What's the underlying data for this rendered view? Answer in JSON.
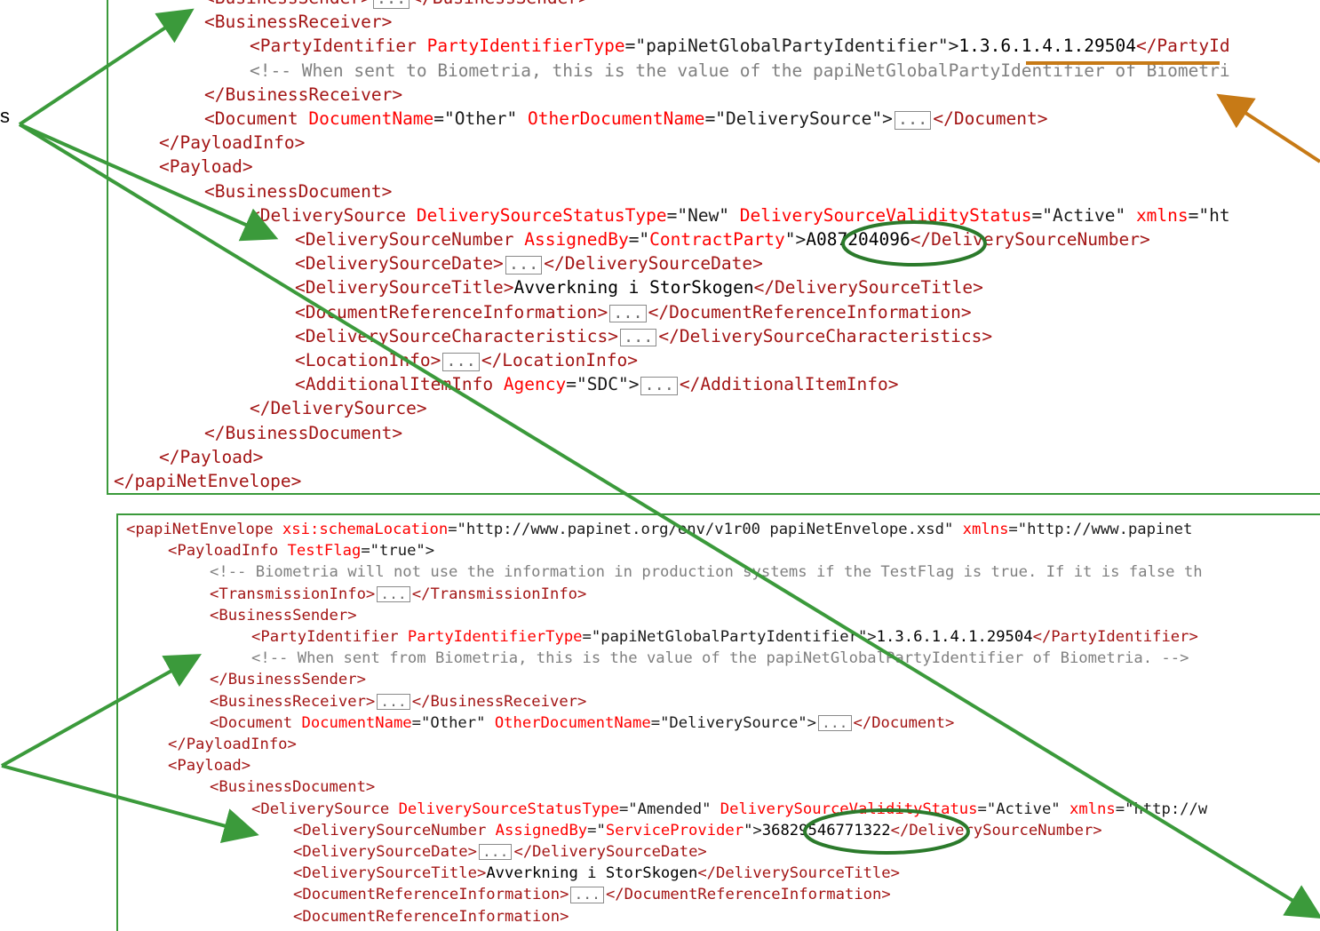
{
  "left_label": "s",
  "top_panel": {
    "lines": [
      {
        "indent": 0,
        "parts": [
          [
            "t",
            "<BusinessSender>"
          ],
          [
            "f",
            "..."
          ],
          [
            "t",
            "</BusinessSender>"
          ]
        ]
      },
      {
        "indent": 0,
        "parts": [
          [
            "t",
            "<BusinessReceiver>"
          ]
        ]
      },
      {
        "indent": 1,
        "parts": [
          [
            "t",
            "<PartyIdentifier "
          ],
          [
            "a",
            "PartyIdentifierType"
          ],
          [
            "v",
            "=\""
          ],
          [
            "v",
            "papiNetGlobalPartyIdentifier"
          ],
          [
            "v",
            "\">"
          ],
          [
            "tx",
            "1.3.6.1.4.1.29504"
          ],
          [
            "t",
            "</PartyId"
          ]
        ]
      },
      {
        "indent": 1,
        "parts": [
          [
            "c",
            "<!-- When sent to Biometria, this is the value of the papiNetGlobalPartyIdentifier of Biometri"
          ]
        ]
      },
      {
        "indent": 0,
        "parts": [
          [
            "t",
            "</BusinessReceiver>"
          ]
        ]
      },
      {
        "indent": 0,
        "parts": [
          [
            "t",
            "<Document "
          ],
          [
            "a",
            "DocumentName"
          ],
          [
            "v",
            "=\"Other\" "
          ],
          [
            "a",
            "OtherDocumentName"
          ],
          [
            "v",
            "=\"DeliverySource\">"
          ],
          [
            "f",
            "..."
          ],
          [
            "t",
            "</Document>"
          ]
        ]
      },
      {
        "indent": -1,
        "parts": [
          [
            "t",
            "</PayloadInfo>"
          ]
        ]
      },
      {
        "indent": -1,
        "parts": [
          [
            "t",
            "<Payload>"
          ]
        ]
      },
      {
        "indent": 0,
        "parts": [
          [
            "t",
            "<BusinessDocument>"
          ]
        ]
      },
      {
        "indent": 1,
        "parts": [
          [
            "t",
            "<DeliverySource "
          ],
          [
            "a",
            "DeliverySourceStatusType"
          ],
          [
            "v",
            "=\"New\" "
          ],
          [
            "a",
            "DeliverySourceValidityStatus"
          ],
          [
            "v",
            "=\"Active\" "
          ],
          [
            "a",
            "xmlns"
          ],
          [
            "v",
            "=\"ht"
          ]
        ]
      },
      {
        "indent": 2,
        "parts": [
          [
            "t",
            "<DeliverySourceNumber "
          ],
          [
            "a2",
            "AssignedBy"
          ],
          [
            "v",
            "=\""
          ],
          [
            "a",
            "ContractParty"
          ],
          [
            "v",
            "\">"
          ],
          [
            "tx",
            "A087204096"
          ],
          [
            "t",
            "</DeliverySourceNumber>"
          ]
        ]
      },
      {
        "indent": 2,
        "parts": [
          [
            "t",
            "<DeliverySourceDate>"
          ],
          [
            "f",
            "..."
          ],
          [
            "t",
            "</DeliverySourceDate>"
          ]
        ]
      },
      {
        "indent": 2,
        "parts": [
          [
            "t",
            "<DeliverySourceTitle>"
          ],
          [
            "tx",
            "Avverkning i StorSkogen"
          ],
          [
            "t",
            "</DeliverySourceTitle>"
          ]
        ]
      },
      {
        "indent": 2,
        "parts": [
          [
            "t",
            "<DocumentReferenceInformation>"
          ],
          [
            "f",
            "..."
          ],
          [
            "t",
            "</DocumentReferenceInformation>"
          ]
        ]
      },
      {
        "indent": 2,
        "parts": [
          [
            "t",
            "<DeliverySourceCharacteristics>"
          ],
          [
            "f",
            "..."
          ],
          [
            "t",
            "</DeliverySourceCharacteristics>"
          ]
        ]
      },
      {
        "indent": 2,
        "parts": [
          [
            "t",
            "<LocationInfo>"
          ],
          [
            "f",
            "..."
          ],
          [
            "t",
            "</LocationInfo>"
          ]
        ]
      },
      {
        "indent": 2,
        "parts": [
          [
            "t",
            "<AdditionalItemInfo "
          ],
          [
            "a",
            "Agency"
          ],
          [
            "v",
            "=\"SDC\">"
          ],
          [
            "f",
            "..."
          ],
          [
            "t",
            "</AdditionalItemInfo>"
          ]
        ]
      },
      {
        "indent": 1,
        "parts": [
          [
            "t",
            "</DeliverySource>"
          ]
        ]
      },
      {
        "indent": 0,
        "parts": [
          [
            "t",
            "</BusinessDocument>"
          ]
        ]
      },
      {
        "indent": -1,
        "parts": [
          [
            "t",
            "</Payload>"
          ]
        ]
      },
      {
        "indent": -2,
        "parts": [
          [
            "t",
            "</papiNetEnvelope>"
          ]
        ]
      }
    ]
  },
  "bottom_panel": {
    "lines": [
      {
        "indent": -1,
        "parts": [
          [
            "t",
            "<papiNetEnvelope "
          ],
          [
            "a",
            "xsi:schemaLocation"
          ],
          [
            "v",
            "=\"http://www.papinet.org/env/v1r00 papiNetEnvelope.xsd\" "
          ],
          [
            "a",
            "xmlns"
          ],
          [
            "v",
            "=\"http://www.papinet"
          ]
        ]
      },
      {
        "indent": 0,
        "parts": [
          [
            "t",
            "<PayloadInfo "
          ],
          [
            "a",
            "TestFlag"
          ],
          [
            "v",
            "=\"true\">"
          ]
        ]
      },
      {
        "indent": 1,
        "parts": [
          [
            "c",
            "<!-- Biometria will not use the information in production systems if the TestFlag is true. If it is false th"
          ]
        ]
      },
      {
        "indent": 1,
        "parts": [
          [
            "t",
            "<TransmissionInfo>"
          ],
          [
            "f",
            "..."
          ],
          [
            "t",
            "</TransmissionInfo>"
          ]
        ]
      },
      {
        "indent": 1,
        "parts": [
          [
            "t",
            "<BusinessSender>"
          ]
        ]
      },
      {
        "indent": 2,
        "parts": [
          [
            "t",
            "<PartyIdentifier "
          ],
          [
            "a",
            "PartyIdentifierType"
          ],
          [
            "v",
            "=\"papiNetGlobalPartyIdentifier\">"
          ],
          [
            "tx",
            "1.3.6.1.4.1.29504"
          ],
          [
            "t",
            "</PartyIdentifier>"
          ]
        ]
      },
      {
        "indent": 2,
        "parts": [
          [
            "c",
            "<!-- When sent from Biometria, this is the value of the papiNetGlobalPartyIdentifier of Biometria. -->"
          ]
        ]
      },
      {
        "indent": 1,
        "parts": [
          [
            "t",
            "</BusinessSender>"
          ]
        ]
      },
      {
        "indent": 1,
        "parts": [
          [
            "t",
            "<BusinessReceiver>"
          ],
          [
            "f",
            "..."
          ],
          [
            "t",
            "</BusinessReceiver>"
          ]
        ]
      },
      {
        "indent": 1,
        "parts": [
          [
            "t",
            "<Document "
          ],
          [
            "a",
            "DocumentName"
          ],
          [
            "v",
            "=\"Other\" "
          ],
          [
            "a",
            "OtherDocumentName"
          ],
          [
            "v",
            "=\"DeliverySource\">"
          ],
          [
            "f",
            "..."
          ],
          [
            "t",
            "</Document>"
          ]
        ]
      },
      {
        "indent": 0,
        "parts": [
          [
            "t",
            "</PayloadInfo>"
          ]
        ]
      },
      {
        "indent": 0,
        "parts": [
          [
            "t",
            "<Payload>"
          ]
        ]
      },
      {
        "indent": 1,
        "parts": [
          [
            "t",
            "<BusinessDocument>"
          ]
        ]
      },
      {
        "indent": 2,
        "parts": [
          [
            "t",
            "<DeliverySource "
          ],
          [
            "a",
            "DeliverySourceStatusType"
          ],
          [
            "v",
            "=\"Amended\" "
          ],
          [
            "a",
            "DeliverySourceValidityStatus"
          ],
          [
            "v",
            "=\"Active\" "
          ],
          [
            "a",
            "xmlns"
          ],
          [
            "v",
            "=\"http://w"
          ]
        ]
      },
      {
        "indent": 3,
        "parts": [
          [
            "t",
            "<DeliverySourceNumber "
          ],
          [
            "a2",
            "AssignedBy"
          ],
          [
            "v",
            "=\""
          ],
          [
            "a",
            "ServiceProvider"
          ],
          [
            "v",
            "\">"
          ],
          [
            "tx",
            "36829546771322"
          ],
          [
            "t",
            "</DeliverySourceNumber>"
          ]
        ]
      },
      {
        "indent": 3,
        "parts": [
          [
            "t",
            "<DeliverySourceDate>"
          ],
          [
            "f",
            "..."
          ],
          [
            "t",
            "</DeliverySourceDate>"
          ]
        ]
      },
      {
        "indent": 3,
        "parts": [
          [
            "t",
            "<DeliverySourceTitle>"
          ],
          [
            "tx",
            "Avverkning i StorSkogen"
          ],
          [
            "t",
            "</DeliverySourceTitle>"
          ]
        ]
      },
      {
        "indent": 3,
        "parts": [
          [
            "t",
            "<DocumentReferenceInformation>"
          ],
          [
            "f",
            "..."
          ],
          [
            "t",
            "</DocumentReferenceInformation>"
          ]
        ]
      },
      {
        "indent": 3,
        "parts": [
          [
            "t",
            "<DocumentReferenceInformation>"
          ]
        ]
      }
    ]
  },
  "colors": {
    "annotation_green": "#3b9a3b",
    "annotation_orange": "#c77a16",
    "tag": "#a31515",
    "attribute": "#ff0000",
    "value": "#0000ff",
    "comment": "#808080"
  }
}
